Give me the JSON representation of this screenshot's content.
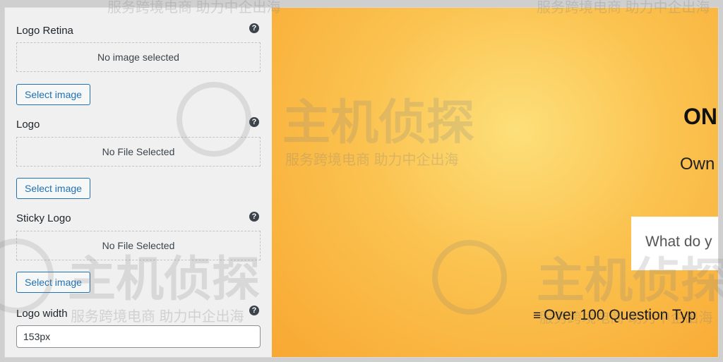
{
  "settings": {
    "logo_retina": {
      "label": "Logo Retina",
      "status": "No image selected",
      "button": "Select image"
    },
    "logo": {
      "label": "Logo",
      "status": "No File Selected",
      "button": "Select image"
    },
    "sticky_logo": {
      "label": "Sticky Logo",
      "status": "No File Selected",
      "button": "Select image"
    },
    "logo_width": {
      "label": "Logo width",
      "value": "153px"
    },
    "help_glyph": "?"
  },
  "preview": {
    "heading": "ON",
    "subheading": "Own",
    "card_text": "What do y",
    "feature_text": "Over 100 Question Typ",
    "feature_icon": "list-icon"
  },
  "watermark": {
    "title": "主机侦探",
    "subtitle": "服务跨境电商 助力中企出海"
  }
}
